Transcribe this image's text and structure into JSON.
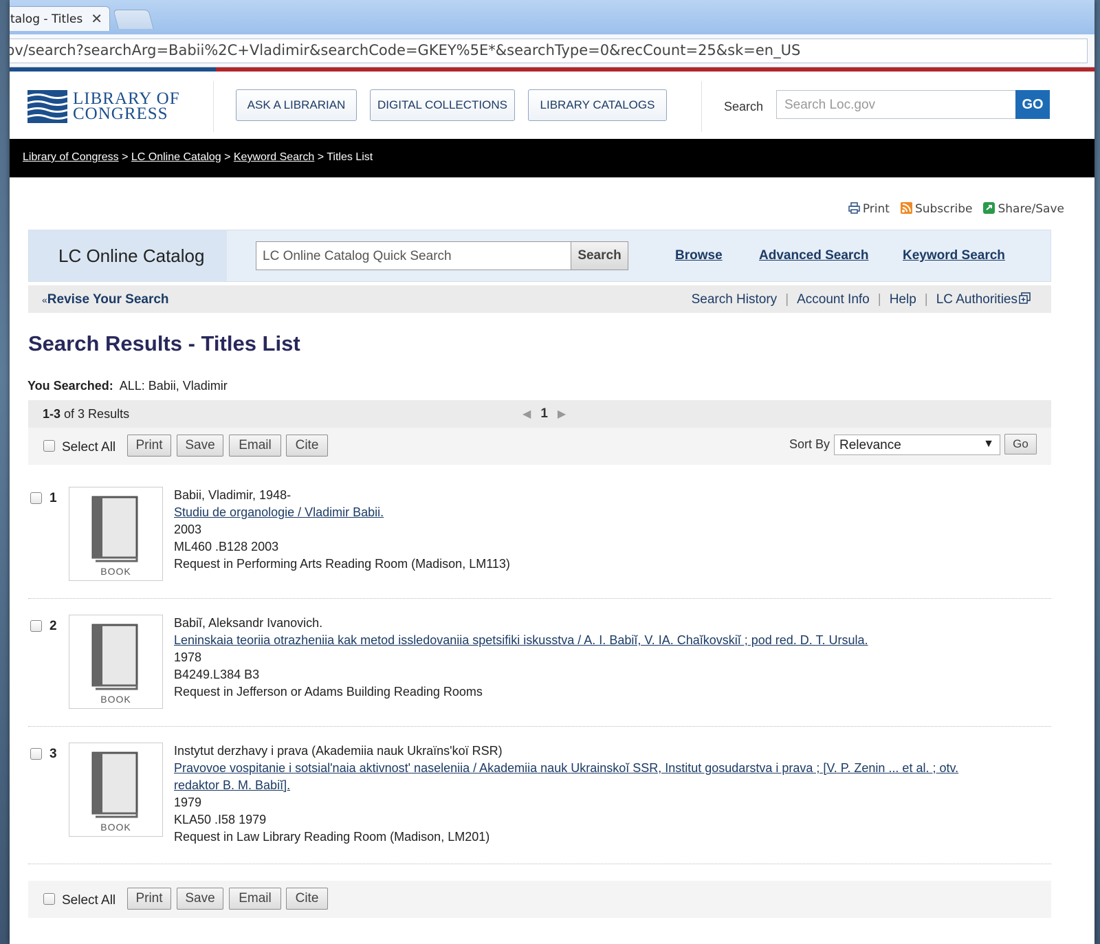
{
  "browser": {
    "tab_title": "talog - Titles",
    "tab_close": "✕",
    "url": "bv/search?searchArg=Babii%2C+Vladimir&searchCode=GKEY%5E*&searchType=0&recCount=25&sk=en_US"
  },
  "header": {
    "logo_line1": "LIBRARY OF",
    "logo_line2": "CONGRESS",
    "nav_buttons": [
      "ASK A LIBRARIAN",
      "DIGITAL COLLECTIONS",
      "LIBRARY CATALOGS"
    ],
    "search_label": "Search",
    "search_placeholder": "Search Loc.gov",
    "go_label": "GO"
  },
  "breadcrumb": {
    "items": [
      "Library of Congress",
      "LC Online Catalog",
      "Keyword Search"
    ],
    "separator": ">",
    "current": "Titles List"
  },
  "tools": {
    "print": "Print",
    "subscribe": "Subscribe",
    "share": "Share/Save"
  },
  "catalog": {
    "name": "LC Online Catalog",
    "quick_search_placeholder": "LC Online Catalog Quick Search",
    "search_button": "Search",
    "links": [
      "Browse",
      "Advanced Search",
      "Keyword Search"
    ]
  },
  "subnav": {
    "revise_arrow": "«",
    "revise": "Revise Your Search",
    "links": [
      "Search History",
      "Account Info",
      "Help",
      "LC Authorities"
    ],
    "separator": "|"
  },
  "results": {
    "heading": "Search Results - Titles List",
    "you_searched_label": "You Searched:",
    "you_searched_value": "ALL: Babii, Vladimir",
    "range": "1-3",
    "count_text": "of 3 Results",
    "current_page": "1",
    "prev_arrow": "◀",
    "next_arrow": "▶",
    "select_all": "Select All",
    "actions": [
      "Print",
      "Save",
      "Email",
      "Cite"
    ],
    "sort_label": "Sort By",
    "sort_value": "Relevance",
    "sort_arrow": "▼",
    "go_label": "Go",
    "items": [
      {
        "number": "1",
        "format": "BOOK",
        "author": "Babii, Vladimir, 1948-",
        "title": "Studiu de organologie / Vladimir Babii.",
        "date": "2003",
        "call_number": "ML460 .B128 2003",
        "location": "Request in Performing Arts Reading Room (Madison, LM113)"
      },
      {
        "number": "2",
        "format": "BOOK",
        "author": "Babiĭ, Aleksandr Ivanovich.",
        "title": "Leninskaia teoriia otrazheniia kak metod issledovaniia spetsifiki iskusstva / A. I. Babiĭ, V. IA. Chaĭkovskiĭ ; pod red. D. T. Ursula.",
        "date": "1978",
        "call_number": "B4249.L384 B3",
        "location": "Request in Jefferson or Adams Building Reading Rooms"
      },
      {
        "number": "3",
        "format": "BOOK",
        "author": "Instytut derzhavy i prava (Akademiia nauk Ukraïns'koï RSR)",
        "title": "Pravovoe vospitanie i sotsial'naia aktivnost' naseleniia / Akademiia nauk Ukrainskoĭ SSR, Institut gosudarstva i prava ; [V. P. Zenin ... et al. ; otv. redaktor B. M. Babiĭ].",
        "date": "1979",
        "call_number": "KLA50 .I58 1979",
        "location": "Request in Law Library Reading Room (Madison, LM201)"
      }
    ]
  }
}
